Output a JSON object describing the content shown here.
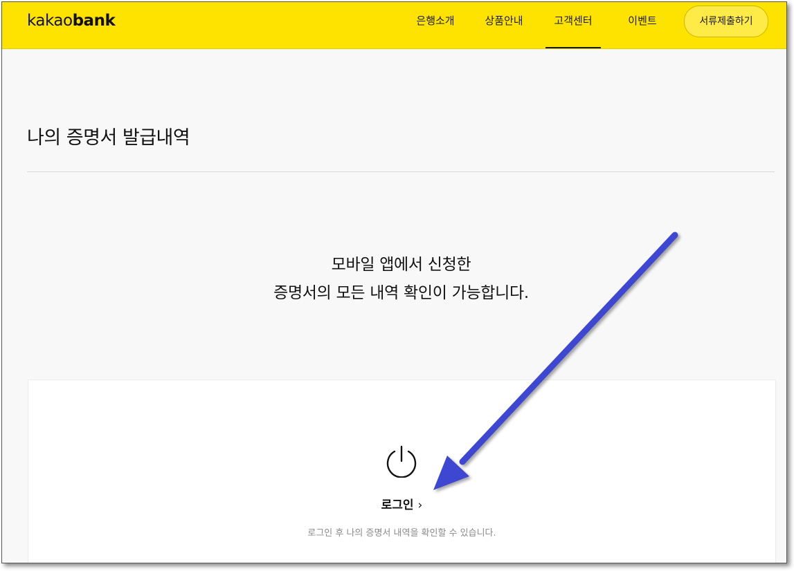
{
  "header": {
    "logo_part1": "kakao",
    "logo_part2": "bank",
    "nav": [
      {
        "label": "은행소개"
      },
      {
        "label": "상품안내"
      },
      {
        "label": "고객센터",
        "active": true
      },
      {
        "label": "이벤트"
      }
    ],
    "cta_label": "서류제출하기"
  },
  "main": {
    "title": "나의 증명서 발급내역",
    "headline_line1": "모바일 앱에서 신청한",
    "headline_line2": "증명서의 모든 내역 확인이 가능합니다.",
    "login": {
      "icon": "power-icon",
      "label": "로그인",
      "chevron": "›",
      "description": "로그인 후 나의 증명서 내역을 확인할 수 있습니다."
    }
  },
  "colors": {
    "header_bg": "#ffe300",
    "page_bg": "#f8f8f8",
    "annotation_arrow": "#3c46d2"
  }
}
